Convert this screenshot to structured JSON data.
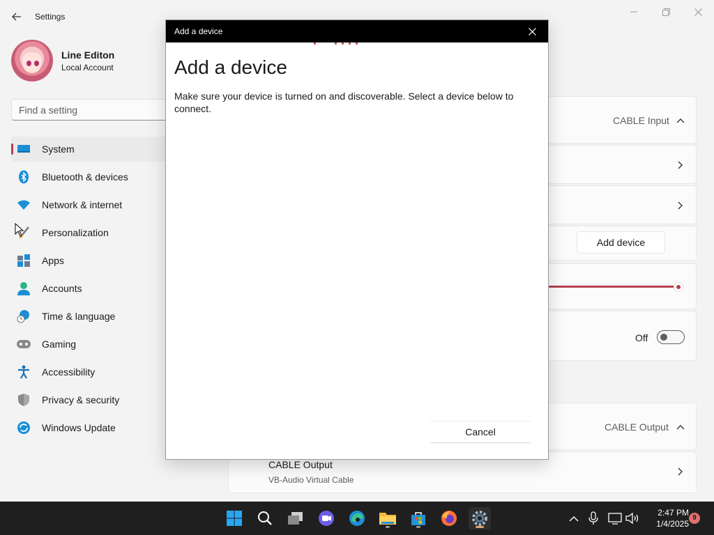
{
  "settings": {
    "app_title": "Settings",
    "user": {
      "name": "Line Editon",
      "account_type": "Local Account"
    },
    "search_placeholder": "Find a setting",
    "nav_items": [
      {
        "label": "System",
        "icon": "monitor-icon",
        "active": true
      },
      {
        "label": "Bluetooth & devices",
        "icon": "bluetooth-icon"
      },
      {
        "label": "Network & internet",
        "icon": "wifi-icon"
      },
      {
        "label": "Personalization",
        "icon": "brush-icon"
      },
      {
        "label": "Apps",
        "icon": "apps-icon"
      },
      {
        "label": "Accounts",
        "icon": "person-icon"
      },
      {
        "label": "Time & language",
        "icon": "globe-clock-icon"
      },
      {
        "label": "Gaming",
        "icon": "gamepad-icon"
      },
      {
        "label": "Accessibility",
        "icon": "accessibility-icon"
      },
      {
        "label": "Privacy & security",
        "icon": "shield-icon"
      },
      {
        "label": "Windows Update",
        "icon": "update-icon"
      }
    ],
    "content": {
      "input_device_value": "CABLE Input",
      "add_device_label": "Add device",
      "volume_percent": 100,
      "toggle_label": "Off",
      "output_device_value": "CABLE Output",
      "output_item": {
        "name": "CABLE Output",
        "desc": "VB-Audio Virtual Cable"
      }
    },
    "accent_color": "#b6404c"
  },
  "dialog": {
    "window_title": "Add a device",
    "heading": "Add a device",
    "description": "Make sure your device is turned on and discoverable. Select a device below to connect.",
    "cancel_label": "Cancel"
  },
  "taskbar": {
    "pinned": [
      {
        "name": "start-button",
        "icon": "windows-logo-icon"
      },
      {
        "name": "search-button",
        "icon": "search-icon"
      },
      {
        "name": "task-view-button",
        "icon": "task-view-icon"
      },
      {
        "name": "chat-button",
        "icon": "chat-icon"
      },
      {
        "name": "edge-button",
        "icon": "edge-icon"
      },
      {
        "name": "file-explorer-button",
        "icon": "folder-icon"
      },
      {
        "name": "store-button",
        "icon": "store-icon"
      },
      {
        "name": "firefox-button",
        "icon": "firefox-icon"
      },
      {
        "name": "settings-button",
        "icon": "gear-icon",
        "active": true
      }
    ],
    "time": "2:47 PM",
    "date": "1/4/2025",
    "notification_count": "9"
  }
}
